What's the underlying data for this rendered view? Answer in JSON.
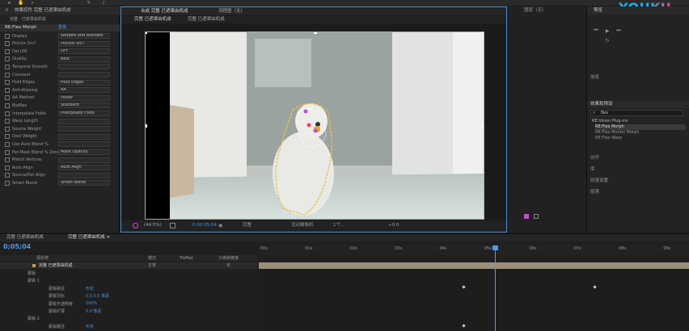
{
  "brand": {
    "logo": "YOUKU"
  },
  "project_panel": {
    "tab": "效果控件 完整 已遮罩由机成",
    "comp_label": "完整 · 已遮罩由机成",
    "effect_header": "RE:Flex Morph",
    "reset": "重置",
    "rows": [
      {
        "label": "Display",
        "value": "Warped and Blended"
      },
      {
        "label": "Picture Src?",
        "value": "Picture Src?"
      },
      {
        "label": "Dst LYR",
        "value": "OFF"
      },
      {
        "label": "Quality",
        "value": "Best"
      },
      {
        "label": "Temporal Smooth",
        "value": ""
      },
      {
        "label": "Constant",
        "value": ""
      },
      {
        "label": "Hold Edges",
        "value": "Hold Edges"
      },
      {
        "label": "Anti-Aliasing",
        "value": "AA"
      },
      {
        "label": "AA Method",
        "value": "Faster"
      },
      {
        "label": "BlaMax",
        "value": "Standard"
      },
      {
        "label": "Interpolate Folds",
        "value": "Interpolate Folds"
      },
      {
        "label": "Warp Length",
        "value": ""
      },
      {
        "label": "Source Weight",
        "value": ""
      },
      {
        "label": "Dest Weight",
        "value": ""
      },
      {
        "label": "Use Auto Blend %",
        "value": ""
      },
      {
        "label": "Per-Mask Blend % Zones",
        "value": "Mask Opacity"
      },
      {
        "label": "Match Vertices",
        "value": ""
      },
      {
        "label": "Auto Align",
        "value": "Auto Align"
      },
      {
        "label": "Source/Dst Align",
        "value": ""
      },
      {
        "label": "Smart Blend",
        "value": "Smart Blend"
      }
    ]
  },
  "comp_panel": {
    "tab_main": "合成 完整 已遮罩由机成",
    "tab_second": "流程图（无）",
    "subtab_1": "完整 已遮罩由机成",
    "subtab_2": "完整 已遮罩由机成",
    "zoom": "(44.5%)",
    "timecode": "0:00:05:04",
    "quality": "完整",
    "view": "活动摄像机",
    "views_count": "1个...",
    "offset": "+0.0"
  },
  "right_panel": {
    "preview_tab": "预览",
    "info_tab": "信息",
    "effects_tab": "效果和预设",
    "search_value": "flex",
    "tree_group": "RE:Vision Plug-ins",
    "tree_items": [
      "RE:Flex Morph",
      "RE:Flex Motion Morph",
      "RE:Flex Warp"
    ],
    "align": "对齐",
    "libraries": "库",
    "char": "段落设置",
    "paragraph": "段落"
  },
  "comp_top_right": {
    "label": "图层（无）"
  },
  "timeline": {
    "tab_1": "完整 已遮罩由机成",
    "tab_2": "完整 已遮罩由机成 ×",
    "timecode": "0;05;04",
    "col_source": "源名称",
    "col_mode": "模式",
    "col_trk": "TrkMat",
    "col_parent": "父级和链接",
    "layer_name": "完整 已遮罩由机成",
    "layer_mode": "正常",
    "parent_value": "无",
    "sub_rows": [
      {
        "label": "蒙版",
        "value": ""
      },
      {
        "label": "蒙版 1",
        "value": ""
      },
      {
        "label": "蒙版路径",
        "value": "形状"
      },
      {
        "label": "蒙版羽化",
        "value": "0.0,0.0 像素"
      },
      {
        "label": "蒙版不透明度",
        "value": "100%"
      },
      {
        "label": "蒙版扩展",
        "value": "0.0 像素"
      },
      {
        "label": "蒙版 2",
        "value": ""
      },
      {
        "label": "蒙版路径",
        "value": "形状"
      }
    ],
    "ruler": [
      "00s",
      "01s",
      "02s",
      "03s",
      "04s",
      "05s",
      "06s",
      "07s",
      "08s",
      "09s"
    ]
  },
  "colors": {
    "accent": "#4a8fd8",
    "playhead": "#4a9cf0",
    "logo_blue": "#1bb0ef",
    "logo_pink": "#f2447f",
    "mask": "#e8c24a"
  }
}
